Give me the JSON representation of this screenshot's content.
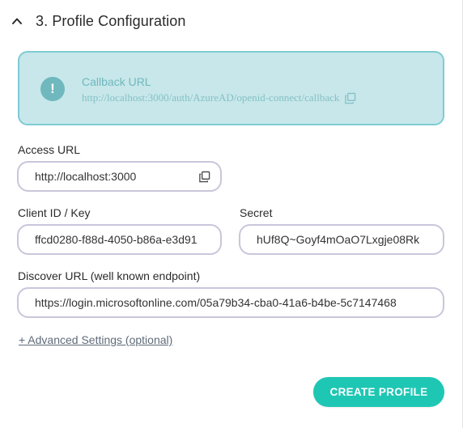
{
  "section": {
    "title": "3. Profile Configuration"
  },
  "callout": {
    "icon": "!",
    "title": "Callback URL",
    "url": "http://localhost:3000/auth/AzureAD/openid-connect/callback"
  },
  "fields": {
    "access_url": {
      "label": "Access URL",
      "value": "http://localhost:3000"
    },
    "client_id": {
      "label": "Client ID / Key",
      "value": "ffcd0280-f88d-4050-b86a-e3d91"
    },
    "secret": {
      "label": "Secret",
      "value": "hUf8Q~Goyf4mOaO7Lxgje08Rk"
    },
    "discover_url": {
      "label": "Discover URL (well known endpoint)",
      "value": "https://login.microsoftonline.com/05a79b34-cba0-41a6-b4be-5c7147468"
    }
  },
  "advanced_link": "+ Advanced Settings (optional)",
  "create_button": "CREATE PROFILE",
  "colors": {
    "accent": "#1ec7b4",
    "callout_bg": "#c7e7ea",
    "callout_border": "#7fcbd3",
    "callout_text": "#6fb8be",
    "field_border": "#c9c6dc"
  },
  "icons": {
    "collapse": "chevron-up-icon",
    "info": "exclamation-icon",
    "copy": "copy-icon"
  }
}
